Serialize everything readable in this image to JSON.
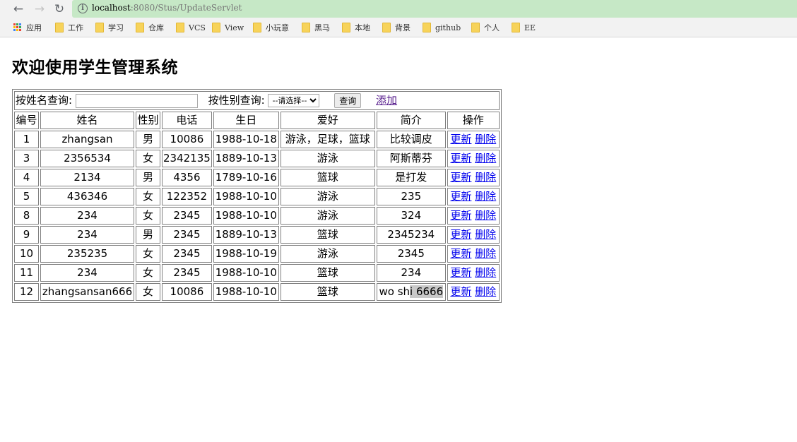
{
  "browser": {
    "url_host": "localhost",
    "url_rest": ":8080/Stus/UpdateServlet",
    "bookmarks": [
      "应用",
      "工作",
      "学习",
      "仓库",
      "VCS",
      "View",
      "小玩意",
      "黑马",
      "本地",
      "背景",
      "github",
      "个人",
      "EE"
    ]
  },
  "page": {
    "title": "欢迎使用学生管理系统"
  },
  "search": {
    "name_label": "按姓名查询:",
    "name_value": "",
    "gender_label": "按性别查询:",
    "gender_selected": "--请选择--",
    "query_button": "查询",
    "add_link": "添加"
  },
  "table": {
    "headers": [
      "编号",
      "姓名",
      "性别",
      "电话",
      "生日",
      "爱好",
      "简介",
      "操作"
    ],
    "update_label": "更新",
    "delete_label": "删除",
    "rows": [
      {
        "id": "1",
        "name": "zhangsan",
        "gender": "男",
        "phone": "10086",
        "birthday": "1988-10-18",
        "hobby": "游泳，足球，篮球",
        "intro": "比较调皮"
      },
      {
        "id": "3",
        "name": "2356534",
        "gender": "女",
        "phone": "2342135",
        "birthday": "1889-10-13",
        "hobby": "游泳",
        "intro": "阿斯蒂芬"
      },
      {
        "id": "4",
        "name": "2134",
        "gender": "男",
        "phone": "4356",
        "birthday": "1789-10-16",
        "hobby": "篮球",
        "intro": "是打发"
      },
      {
        "id": "5",
        "name": "436346",
        "gender": "女",
        "phone": "122352",
        "birthday": "1988-10-10",
        "hobby": "游泳",
        "intro": "235"
      },
      {
        "id": "8",
        "name": "234",
        "gender": "女",
        "phone": "2345",
        "birthday": "1988-10-10",
        "hobby": "游泳",
        "intro": "324"
      },
      {
        "id": "9",
        "name": "234",
        "gender": "男",
        "phone": "2345",
        "birthday": "1889-10-13",
        "hobby": "篮球",
        "intro": "2345234"
      },
      {
        "id": "10",
        "name": "235235",
        "gender": "女",
        "phone": "2345",
        "birthday": "1988-10-19",
        "hobby": "游泳",
        "intro": "2345"
      },
      {
        "id": "11",
        "name": "234",
        "gender": "女",
        "phone": "2345",
        "birthday": "1988-10-10",
        "hobby": "篮球",
        "intro": "234"
      },
      {
        "id": "12",
        "name": "zhangsansan666",
        "gender": "女",
        "phone": "10086",
        "birthday": "1988-10-10",
        "hobby": "篮球",
        "intro": "wo sh",
        "intro_highlighted": "i 6666"
      }
    ]
  },
  "colors": {
    "omnibox_bg": "#c6e8c6",
    "link": "#0000ee",
    "visited_link": "#551a8b",
    "border": "#808080"
  }
}
